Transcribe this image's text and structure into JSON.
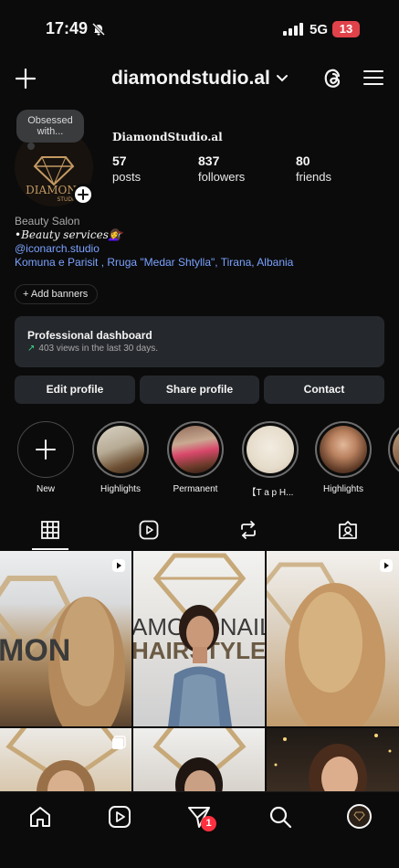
{
  "status": {
    "time": "17:49",
    "network": "5G",
    "battery": "13"
  },
  "header": {
    "username": "diamondstudio.al"
  },
  "note": {
    "text": "Obsessed with..."
  },
  "avatar_logo": {
    "line1": "DIAMON",
    "line2": "STUDIO"
  },
  "profile": {
    "display_name": "DiamondStudio.al",
    "stats": [
      {
        "value": "57",
        "label": "posts"
      },
      {
        "value": "837",
        "label": "followers"
      },
      {
        "value": "80",
        "label": "friends"
      }
    ],
    "category": "Beauty Salon",
    "services": "•Beauty services💇‍♀️",
    "link": "@iconarch.studio",
    "address": "Komuna e Parisit , Rruga \"Medar Shtylla\", Tirana, Albania"
  },
  "add_banners": "+ Add banners",
  "dashboard": {
    "title": "Professional dashboard",
    "subtitle": "403 views in the last 30 days."
  },
  "buttons": {
    "edit": "Edit profile",
    "share": "Share profile",
    "contact": "Contact"
  },
  "highlights": [
    {
      "label": "New"
    },
    {
      "label": "Highlights"
    },
    {
      "label": "Permanent"
    },
    {
      "label": "【T a p    H..."
    },
    {
      "label": "Highlights"
    }
  ],
  "grid_overlay": [
    {
      "text": "AMONDNAILS"
    },
    {
      "text": "HAIRSTYLE"
    }
  ],
  "notifications": {
    "count": "1"
  },
  "colors": {
    "background": "#0b0b0b",
    "card": "#25282c",
    "link": "#7aa2ff",
    "badge": "#ff3040",
    "battery": "#e0424a"
  }
}
